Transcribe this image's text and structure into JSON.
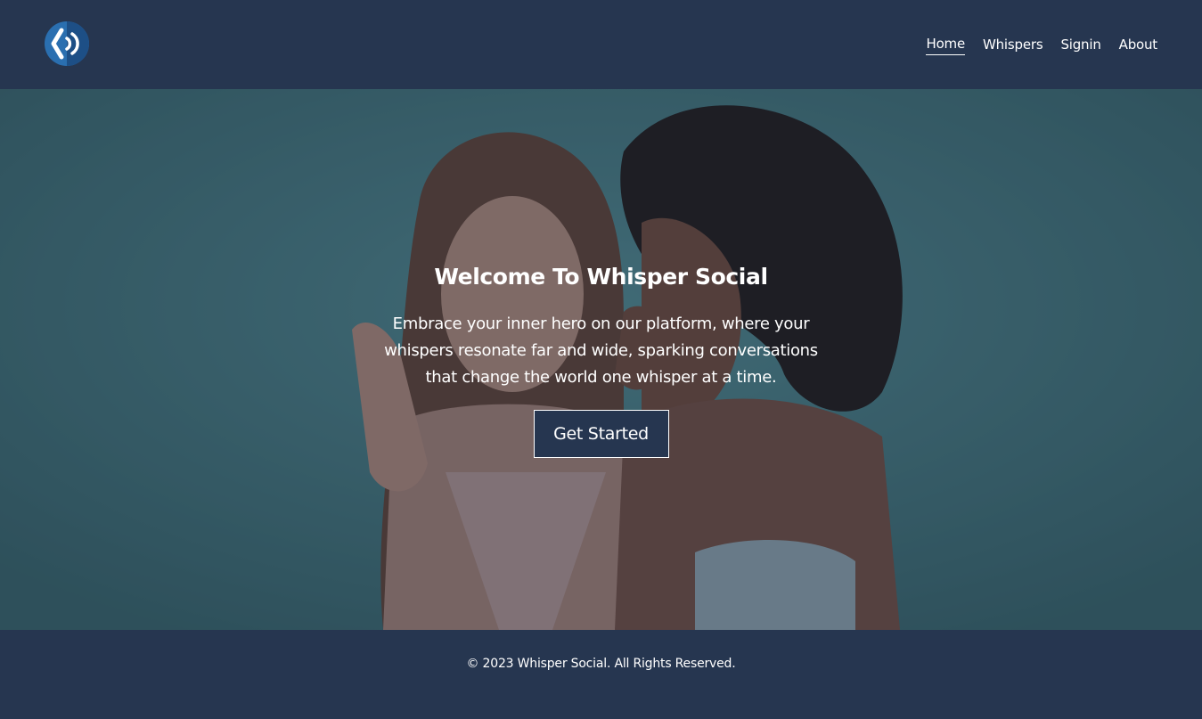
{
  "brand": {
    "logo_icon": "whisper-sound-icon"
  },
  "nav": {
    "items": [
      {
        "label": "Home"
      },
      {
        "label": "Whispers"
      },
      {
        "label": "Signin"
      },
      {
        "label": "About"
      }
    ]
  },
  "hero": {
    "title": "Welcome To Whisper Social",
    "text": "Embrace your inner hero on our platform, where your whispers resonate far and wide, sparking conversations that change the world one whisper at a time.",
    "cta_label": "Get Started"
  },
  "footer": {
    "copyright": "© 2023 Whisper Social. All Rights Reserved."
  },
  "colors": {
    "navy": "#263650",
    "teal_background": "#3f7175",
    "accent_blue": "#2a6fb0",
    "text": "#ffffff"
  }
}
